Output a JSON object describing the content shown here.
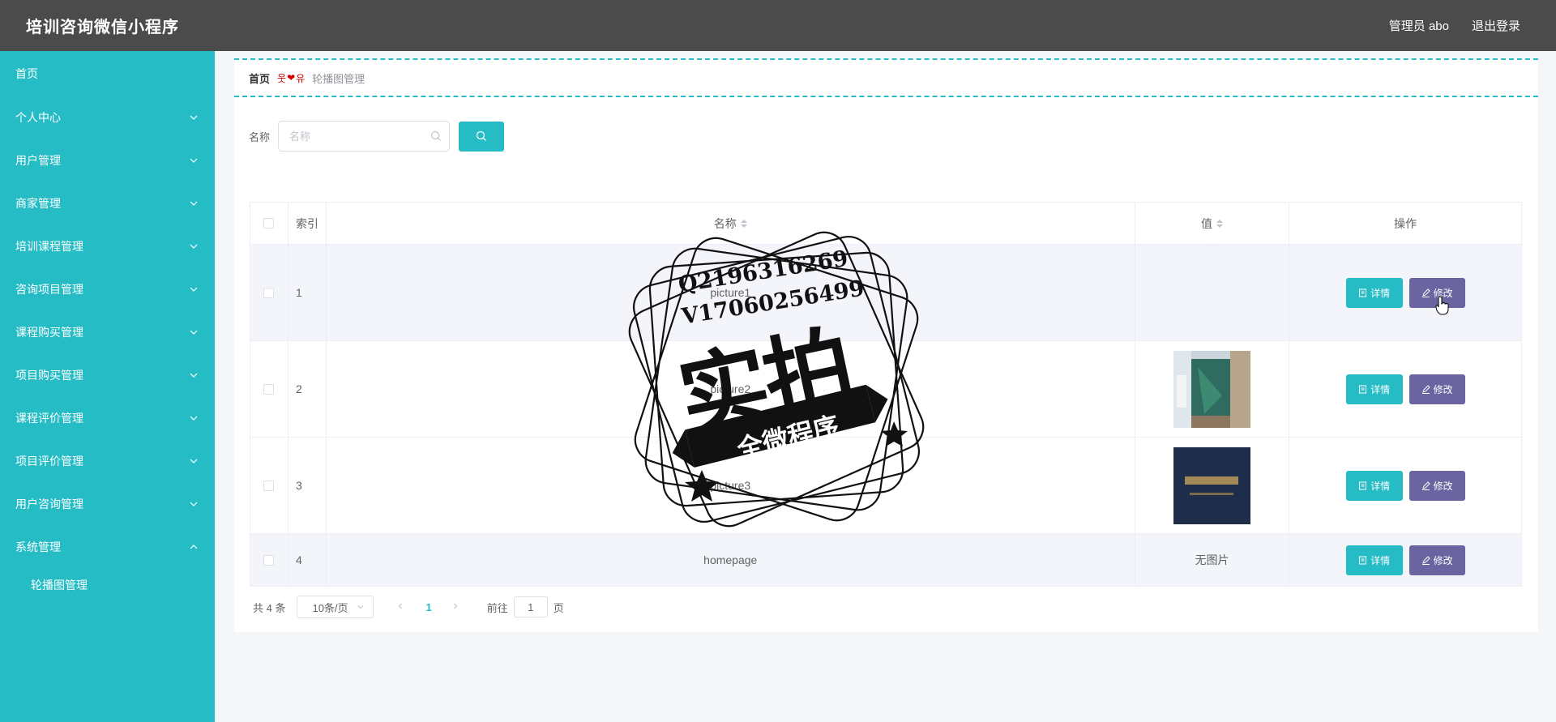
{
  "header": {
    "app_title": "培训咨询微信小程序",
    "user_label": "管理员 abo",
    "logout_label": "退出登录"
  },
  "sidebar": {
    "items": [
      {
        "label": "首页",
        "has_children": false
      },
      {
        "label": "个人中心",
        "has_children": true
      },
      {
        "label": "用户管理",
        "has_children": true
      },
      {
        "label": "商家管理",
        "has_children": true
      },
      {
        "label": "培训课程管理",
        "has_children": true
      },
      {
        "label": "咨询项目管理",
        "has_children": true
      },
      {
        "label": "课程购买管理",
        "has_children": true
      },
      {
        "label": "项目购买管理",
        "has_children": true
      },
      {
        "label": "课程评价管理",
        "has_children": true
      },
      {
        "label": "项目评价管理",
        "has_children": true
      },
      {
        "label": "用户咨询管理",
        "has_children": true
      },
      {
        "label": "系统管理",
        "has_children": true,
        "expanded": true
      }
    ],
    "submenu": [
      {
        "label": "轮播图管理"
      }
    ]
  },
  "breadcrumb": {
    "home": "首页",
    "separator": "❤",
    "current": "轮播图管理"
  },
  "search": {
    "label": "名称",
    "placeholder": "名称",
    "value": ""
  },
  "table": {
    "columns": {
      "index": "索引",
      "name": "名称",
      "value": "值",
      "ops": "操作"
    },
    "rows": [
      {
        "index": "1",
        "name": "picture1",
        "value_type": "image-partial",
        "value_text": ""
      },
      {
        "index": "2",
        "name": "picture2",
        "value_type": "image-room",
        "value_text": ""
      },
      {
        "index": "3",
        "name": "picture3",
        "value_type": "image-dark",
        "value_text": ""
      },
      {
        "index": "4",
        "name": "homepage",
        "value_type": "text",
        "value_text": "无图片"
      }
    ],
    "detail_label": "详情",
    "edit_label": "修改"
  },
  "pagination": {
    "total_text": "共 4 条",
    "page_size": "10条/页",
    "current_page": "1",
    "goto_prefix": "前往",
    "goto_value": "1",
    "goto_suffix": "页"
  },
  "watermark": {
    "line1": "Q2196316269",
    "line2": "V17060256499",
    "big": "实拍",
    "banner": "全微程序"
  },
  "colors": {
    "accent": "#25bcc6",
    "header_bg": "#4b4b4b",
    "edit_button": "#6a64a0"
  }
}
